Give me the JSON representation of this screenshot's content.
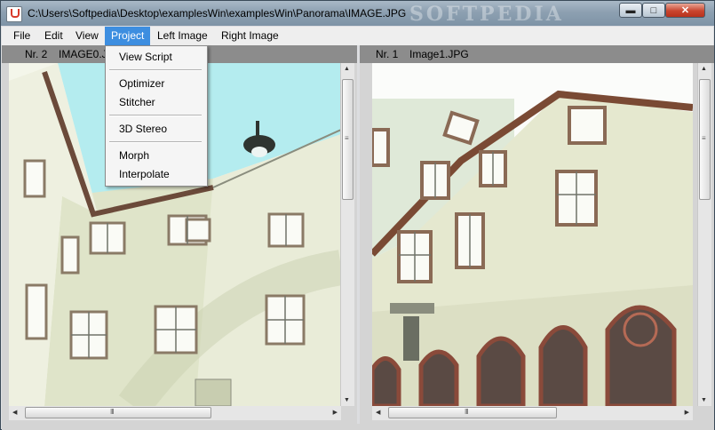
{
  "window": {
    "title": "C:\\Users\\Softpedia\\Desktop\\examplesWin\\examplesWin\\Panorama\\IMAGE.JPG",
    "min_icon": "minimize-icon",
    "max_icon": "maximize-icon",
    "close_icon": "close-icon",
    "min_glyph": "▬",
    "max_glyph": "□",
    "close_glyph": "✕"
  },
  "watermark": "SOFTPEDIA",
  "menubar": {
    "items": [
      "File",
      "Edit",
      "View",
      "Project",
      "Left Image",
      "Right Image"
    ],
    "active": "Project"
  },
  "project_menu": {
    "items": [
      "View Script",
      "Optimizer",
      "Stitcher",
      "3D Stereo",
      "Morph",
      "Interpolate"
    ]
  },
  "left_panel": {
    "nr": "Nr. 2",
    "filename": "IMAGE0.J"
  },
  "right_panel": {
    "nr": "Nr. 1",
    "filename": "Image1.JPG"
  },
  "scrollbar": {
    "up_arrow": "▲",
    "down_arrow": "▼",
    "left_arrow": "◀",
    "right_arrow": "▶",
    "grip_v": "≡",
    "grip_h": "III"
  },
  "colors": {
    "menu_highlight": "#3d8ee0",
    "panel_header": "#8c8c8c",
    "sky_left": "#b4ecef",
    "wall": "#e8ebd6"
  }
}
